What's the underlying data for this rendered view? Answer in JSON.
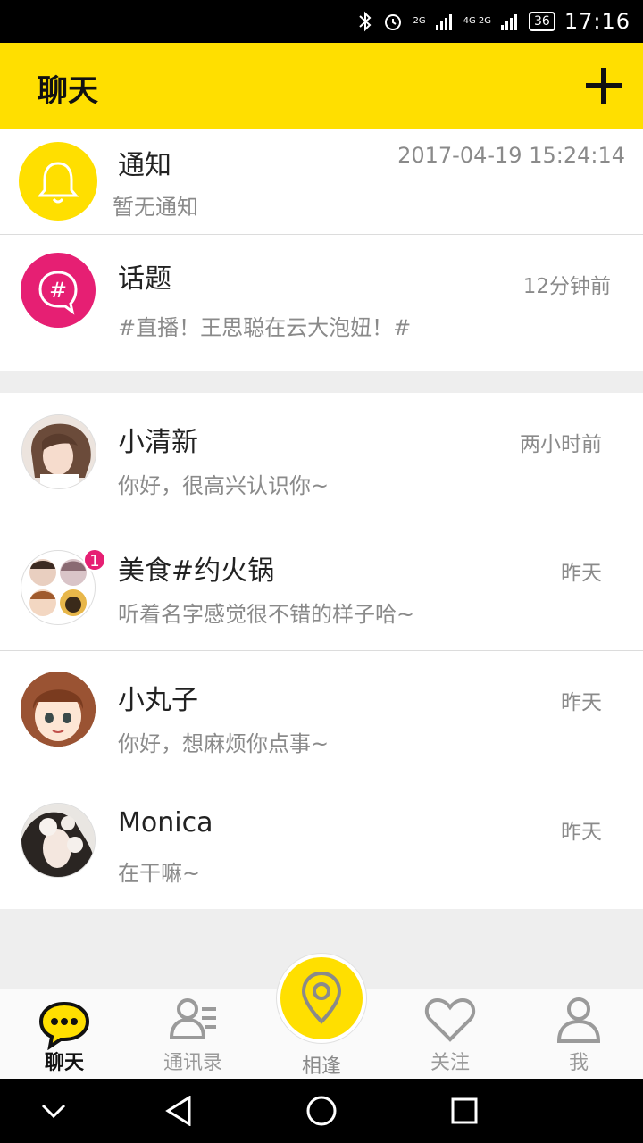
{
  "status_bar": {
    "network_1": "2G",
    "network_2": "4G 2G",
    "battery": "36",
    "time": "17:16"
  },
  "header": {
    "title": "聊天"
  },
  "notification": {
    "name": "通知",
    "message": "暂无通知",
    "time": "2017-04-19  15:24:14"
  },
  "topic": {
    "name": "话题",
    "message": "#直播！王思聪在云大泡妞！#",
    "time": "12分钟前"
  },
  "chats": [
    {
      "name": "小清新",
      "message": "你好，很高兴认识你~",
      "time": "两小时前"
    },
    {
      "name": "美食#约火锅",
      "message": "听着名字感觉很不错的样子哈~",
      "time": "昨天",
      "badge": "1"
    },
    {
      "name": "小丸子",
      "message": "你好，想麻烦你点事~",
      "time": "昨天"
    },
    {
      "name": "Monica",
      "message": "在干嘛~",
      "time": "昨天"
    }
  ],
  "tabs": {
    "chat": "聊天",
    "contacts": "通讯录",
    "meet": "相逢",
    "follow": "关注",
    "me": "我"
  },
  "colors": {
    "accent": "#FFDF00",
    "topic": "#E61F73",
    "badge": "#E61F73"
  }
}
